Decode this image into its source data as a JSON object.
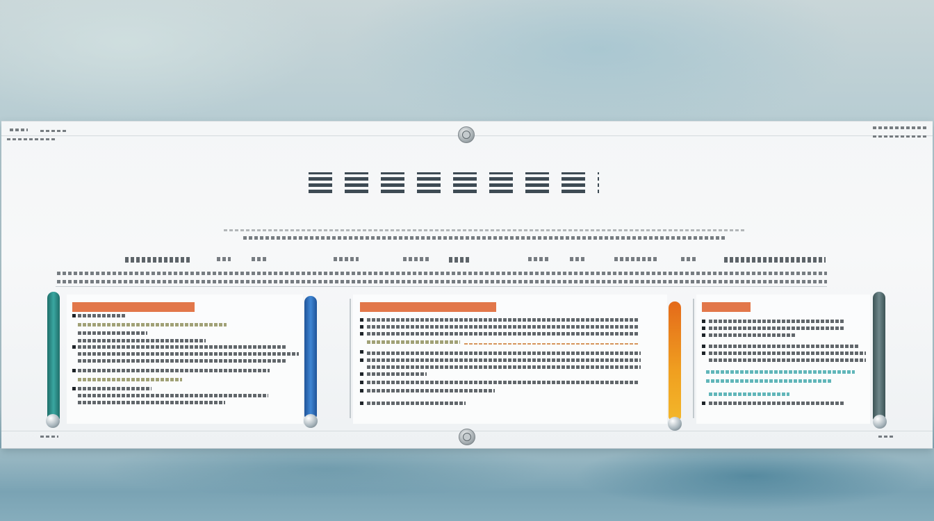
{
  "colors": {
    "teal": "#2a8f8a",
    "blue": "#2f6fb8",
    "orange": "#e08a1c",
    "slate": "#5b7276",
    "label_orange": "#e2774a"
  },
  "icons": [
    "top-knob-icon",
    "bottom-knob-icon"
  ],
  "title": "",
  "panels": [
    {
      "label": ""
    },
    {
      "label": ""
    },
    {
      "label": ""
    }
  ]
}
